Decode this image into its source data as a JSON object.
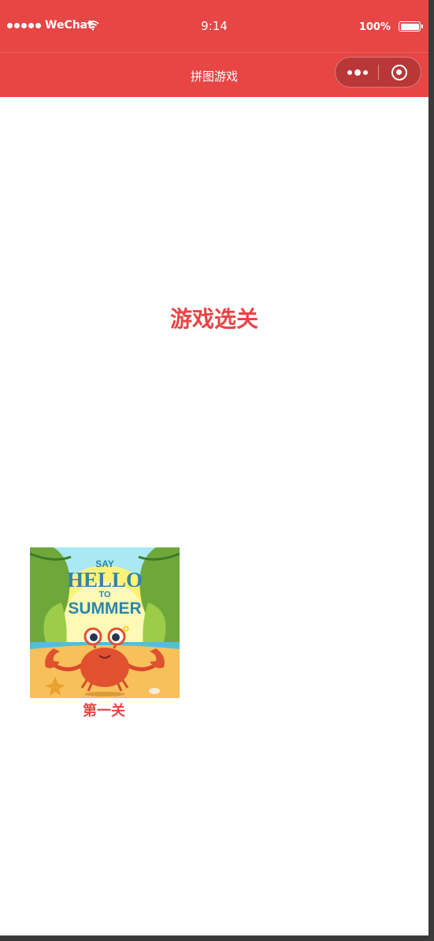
{
  "status_bar": {
    "carrier": "WeChat",
    "time": "9:14",
    "battery": "100%"
  },
  "nav_bar": {
    "title": "拼图游戏"
  },
  "main": {
    "heading": "游戏选关",
    "levels": [
      {
        "label": "第一关",
        "thumbnail_text": [
          "SAY",
          "HELLO",
          "TO",
          "SUMMER"
        ]
      }
    ]
  },
  "colors": {
    "brand_red": "#e84545",
    "white": "#ffffff"
  }
}
